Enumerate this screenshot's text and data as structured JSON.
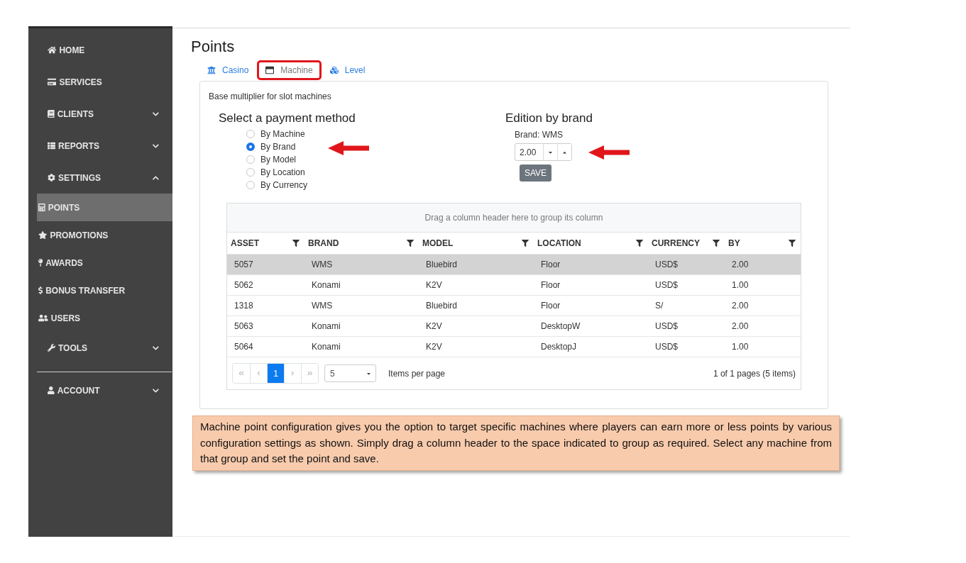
{
  "sidebar": {
    "items": [
      {
        "label": "HOME",
        "kind": "link",
        "selected": false
      },
      {
        "label": "SERVICES",
        "kind": "link",
        "selected": false
      },
      {
        "label": "CLIENTS",
        "kind": "group",
        "selected": false,
        "expanded": false
      },
      {
        "label": "REPORTS",
        "kind": "group",
        "selected": false,
        "expanded": false
      },
      {
        "label": "SETTINGS",
        "kind": "group",
        "selected": false,
        "expanded": true,
        "children": [
          {
            "label": "POINTS",
            "selected": true
          },
          {
            "label": "PROMOTIONS",
            "selected": false
          },
          {
            "label": "AWARDS",
            "selected": false
          },
          {
            "label": "BONUS TRANSFER",
            "selected": false
          },
          {
            "label": "USERS",
            "selected": false
          }
        ]
      },
      {
        "label": "TOOLS",
        "kind": "group",
        "selected": false,
        "expanded": false
      }
    ],
    "bottom_items": [
      {
        "label": "ACCOUNT",
        "kind": "group",
        "selected": false,
        "expanded": false
      }
    ]
  },
  "page_title": "Points",
  "tabs": [
    {
      "label": "Casino",
      "selected": false,
      "highlighted": false
    },
    {
      "label": "Machine",
      "selected": true,
      "highlighted": true
    },
    {
      "label": "Level",
      "selected": false,
      "highlighted": false
    }
  ],
  "panel": {
    "description": "Base multiplier for slot machines",
    "payment_method": {
      "title": "Select a payment method",
      "options": [
        {
          "label": "By Machine",
          "selected": false
        },
        {
          "label": "By Brand",
          "selected": true
        },
        {
          "label": "By Model",
          "selected": false
        },
        {
          "label": "By Location",
          "selected": false
        },
        {
          "label": "By Currency",
          "selected": false
        }
      ]
    },
    "edition": {
      "title": "Edition by brand",
      "brand_label": "Brand: WMS",
      "value": "2.00",
      "save_button": "SAVE"
    },
    "grid": {
      "group_hint": "Drag a column header here to group its column",
      "columns": [
        "ASSET",
        "BRAND",
        "MODEL",
        "LOCATION",
        "CURRENCY",
        "BY"
      ],
      "rows": [
        {
          "cells": [
            "5057",
            "WMS",
            "Bluebird",
            "Floor",
            "USD$",
            "2.00"
          ],
          "selected": true
        },
        {
          "cells": [
            "5062",
            "Konami",
            "K2V",
            "Floor",
            "USD$",
            "1.00"
          ],
          "selected": false
        },
        {
          "cells": [
            "1318",
            "WMS",
            "Bluebird",
            "Floor",
            "S/",
            "2.00"
          ],
          "selected": false
        },
        {
          "cells": [
            "5063",
            "Konami",
            "K2V",
            "DesktopW",
            "USD$",
            "2.00"
          ],
          "selected": false
        },
        {
          "cells": [
            "5064",
            "Konami",
            "K2V",
            "DesktopJ",
            "USD$",
            "1.00"
          ],
          "selected": false
        }
      ],
      "pager": {
        "back_disabled": true,
        "forward_disabled": true,
        "pages": [
          {
            "label": "1",
            "selected": true
          }
        ],
        "page_size": "5",
        "page_size_label": "Items per page",
        "summary": "1 of 1 pages (5 items)"
      }
    }
  },
  "note": "Machine point configuration gives you the option to target specific machines where players can earn more or less points by various configuration settings as shown. Simply drag a column header to the space indicated to group as required. Select any machine from that group and set the point and save."
}
